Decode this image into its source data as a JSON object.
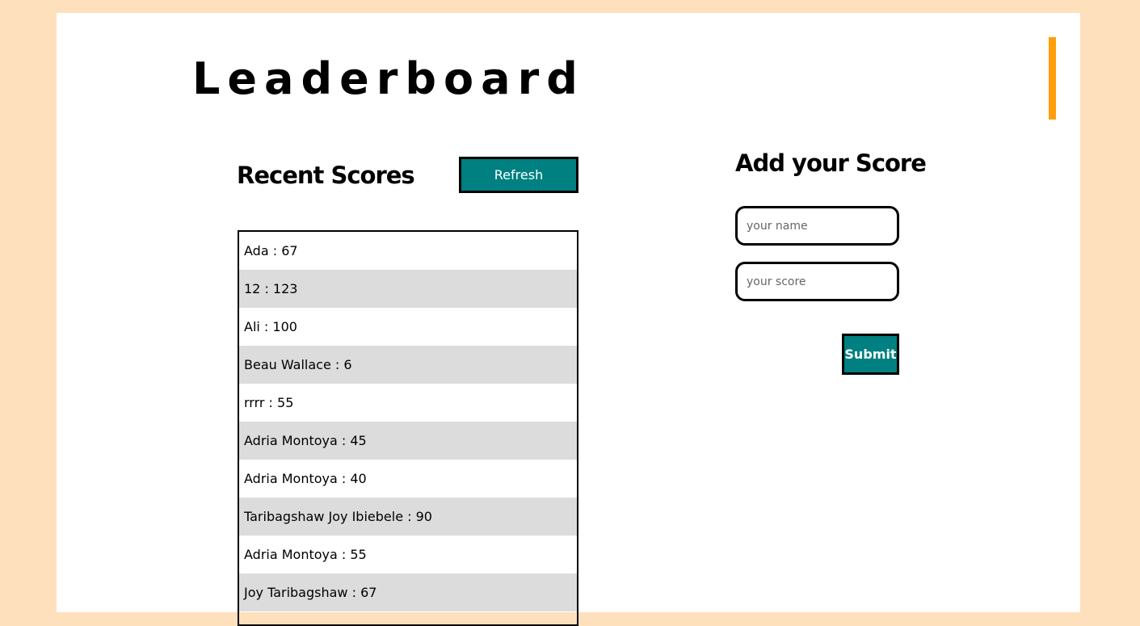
{
  "header": {
    "title": "Leaderboard"
  },
  "recent_scores": {
    "title": "Recent Scores",
    "refresh_label": "Refresh",
    "items": [
      "Ada : 67",
      "12 : 123",
      "Ali : 100",
      "Beau Wallace : 6",
      "rrrr : 55",
      "Adria Montoya : 45",
      "Adria Montoya : 40",
      "Taribagshaw Joy Ibiebele : 90",
      "Adria Montoya : 55",
      "Joy Taribagshaw : 67"
    ]
  },
  "add_score": {
    "title": "Add your Score",
    "name_placeholder": "your name",
    "score_placeholder": "your score",
    "submit_label": "Submit"
  },
  "colors": {
    "page_background": "#ffe0bd",
    "button_background": "#008080",
    "accent": "#ff9e0d",
    "row_alt": "#dcdcdc"
  }
}
